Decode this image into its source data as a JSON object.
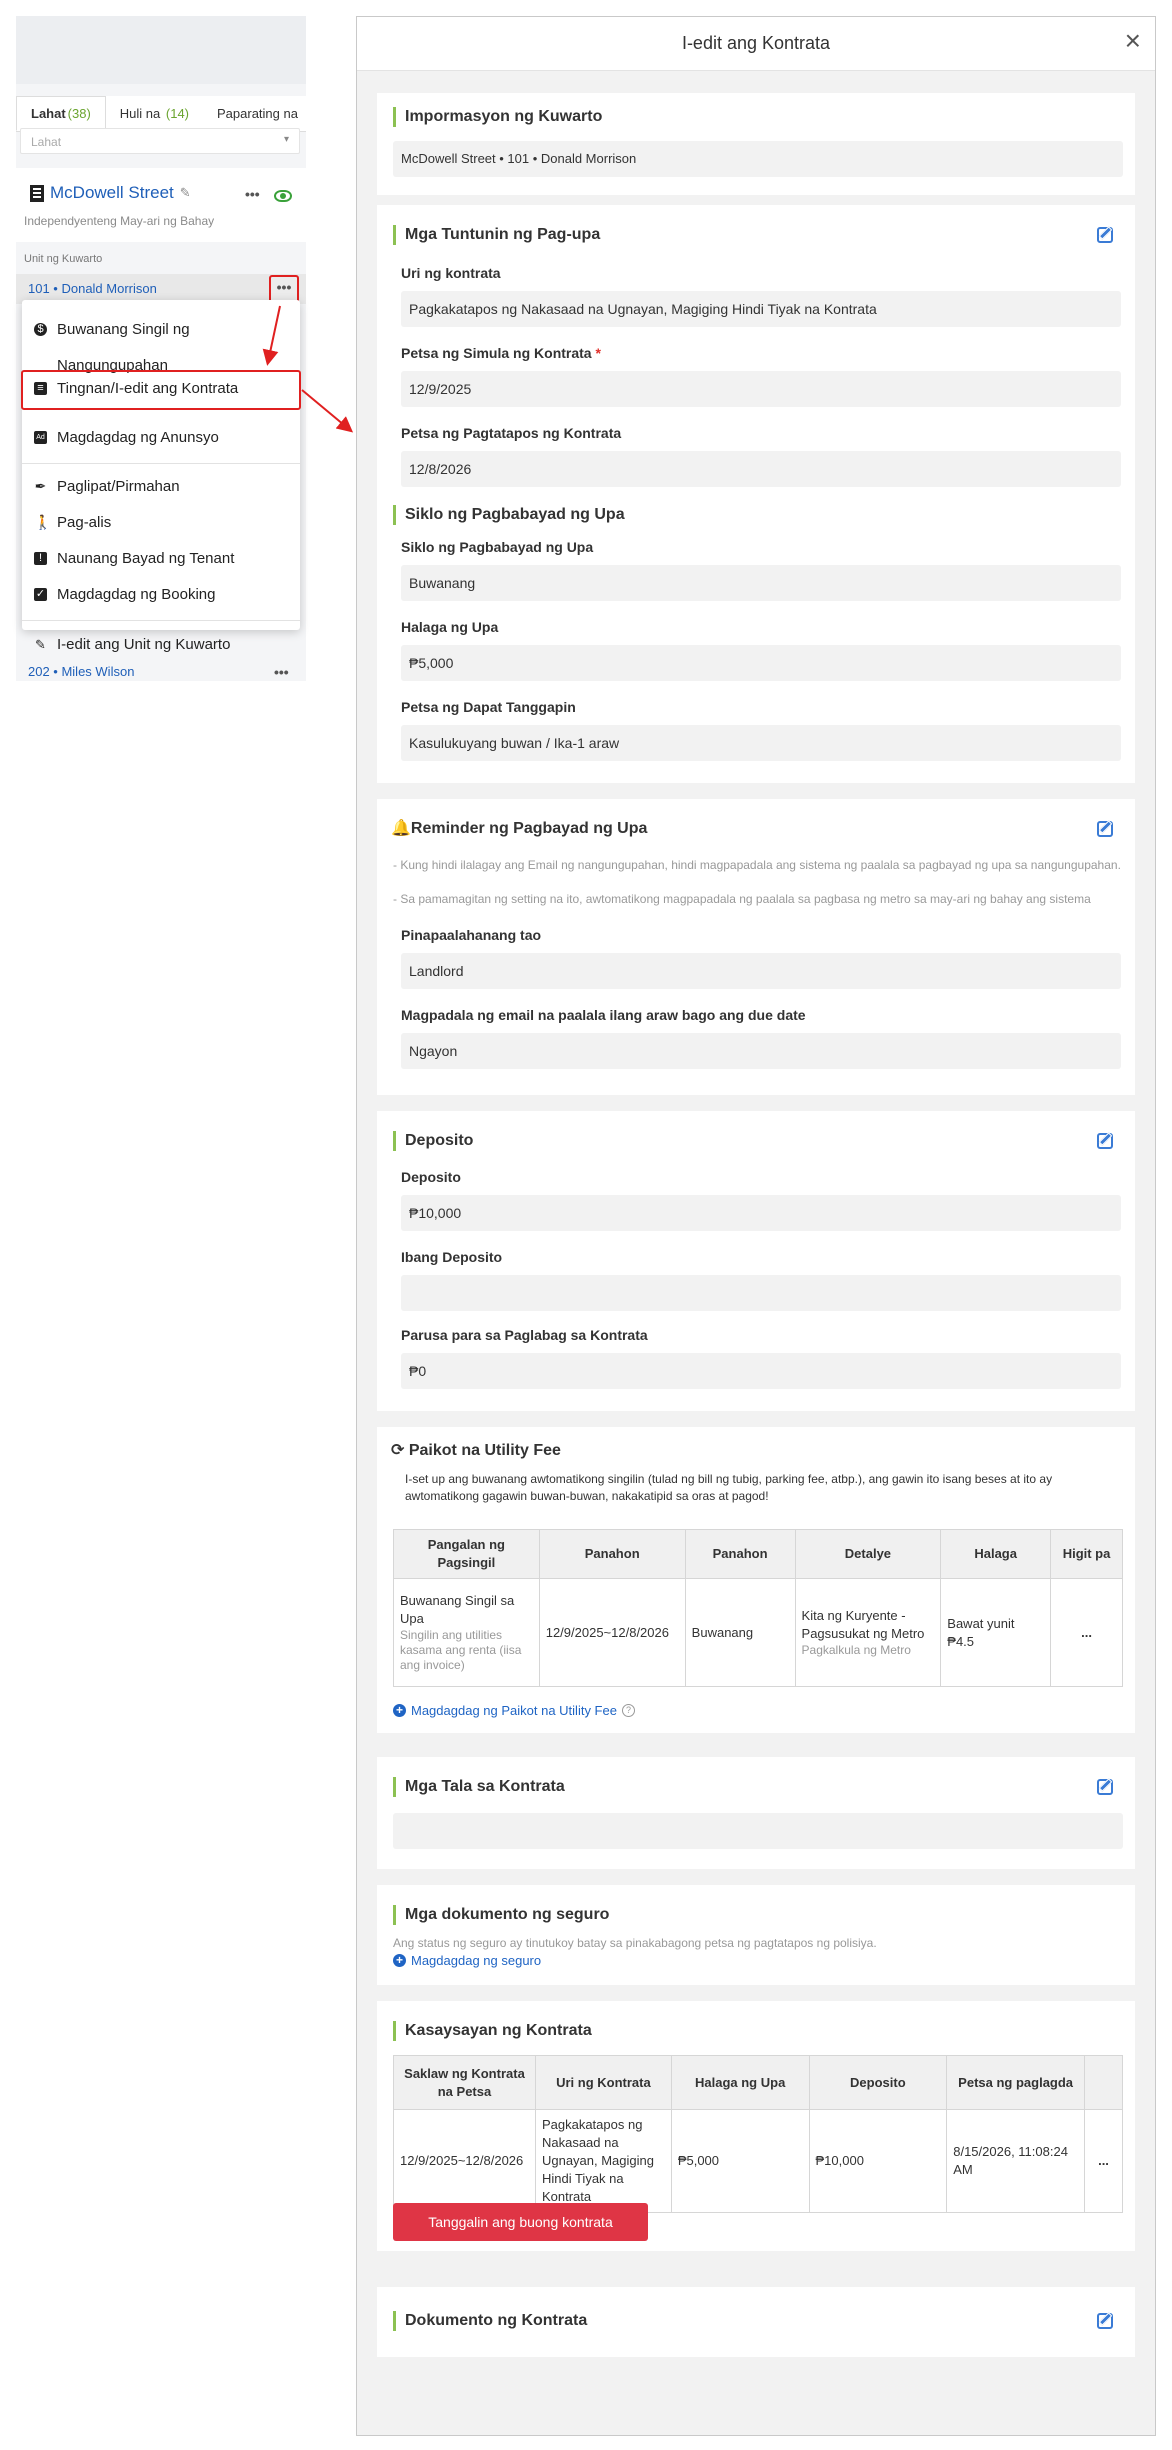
{
  "left": {
    "tabs": [
      {
        "label": "Lahat",
        "count": "(38)"
      },
      {
        "label": "Huli na",
        "count": "(14)"
      },
      {
        "label": "Paparating na",
        "count": ""
      }
    ],
    "filter_value": "Lahat",
    "property_name": "McDowell Street",
    "property_subtitle": "Independyenteng May-ari ng Bahay",
    "unit_header": "Unit ng Kuwarto",
    "unit_row": "101 • Donald Morrison",
    "unit_row2": "202 • Miles Wilson",
    "menu": {
      "items": [
        "Buwanang Singil ng Nangungupahan",
        "Tingnan/I-edit ang Kontrata",
        "Magdagdag ng Anunsyo",
        "Paglipat/Pirmahan",
        "Pag-alis",
        "Naunang Bayad ng Tenant",
        "Magdagdag ng Booking",
        "I-edit ang Unit ng Kuwarto"
      ]
    }
  },
  "modal": {
    "title": "I-edit ang Kontrata",
    "room_info": {
      "title": "Impormasyon ng Kuwarto",
      "value": "McDowell Street • 101 • Donald Morrison"
    },
    "rental_terms": {
      "title": "Mga Tuntunin ng Pag-upa",
      "contract_type_label": "Uri ng kontrata",
      "contract_type": "Pagkakatapos ng Nakasaad na Ugnayan, Magiging Hindi Tiyak na Kontrata",
      "start_label": "Petsa ng Simula ng Kontrata",
      "start": "12/9/2025",
      "end_label": "Petsa ng Pagtatapos ng Kontrata",
      "end": "12/8/2026"
    },
    "payment_cycle": {
      "title": "Siklo ng Pagbabayad ng Upa",
      "cycle_label": "Siklo ng Pagbabayad ng Upa",
      "cycle": "Buwanang",
      "rent_label": "Halaga ng Upa",
      "rent": "₱5,000",
      "due_label": "Petsa ng Dapat Tanggapin",
      "due": "Kasulukuyang buwan / Ika-1 araw"
    },
    "reminder": {
      "title": "Reminder ng Pagbayad ng Upa",
      "note1": "- Kung hindi ilalagay ang Email ng nangungupahan, hindi magpapadala ang sistema ng paalala sa pagbayad ng upa sa nangungupahan.",
      "note2": "- Sa pamamagitan ng setting na ito, awtomatikong magpapadala ng paalala sa pagbasa ng metro sa may-ari ng bahay ang sistema",
      "person_label": "Pinapaalahanang tao",
      "person": "Landlord",
      "days_label": "Magpadala ng email na paalala ilang araw bago ang due date",
      "days": "Ngayon"
    },
    "deposit": {
      "title": "Deposito",
      "deposit_label": "Deposito",
      "deposit": "₱10,000",
      "other_label": "Ibang Deposito",
      "other": "",
      "penalty_label": "Parusa para sa Paglabag sa Kontrata",
      "penalty": "₱0"
    },
    "utility": {
      "title": "Paikot na Utility Fee",
      "note": "I-set up ang buwanang awtomatikong singilin (tulad ng bill ng tubig, parking fee, atbp.), ang gawin ito isang beses at ito ay awtomatikong gagawin buwan-buwan, nakakatipid sa oras at pagod!",
      "headers": [
        "Pangalan ng Pagsingil",
        "Panahon",
        "Panahon",
        "Detalye",
        "Halaga",
        "Higit pa"
      ],
      "row": {
        "name": "Buwanang Singil sa Upa",
        "name_sub": "Singilin ang utilities kasama ang renta (iisa ang invoice)",
        "period": "12/9/2025~12/8/2026",
        "cycle": "Buwanang",
        "detail": "Kita ng Kuryente - Pagsusukat ng Metro",
        "detail_sub": "Pagkalkula ng Metro",
        "amount": "Bawat yunit ₱4.5",
        "more": "..."
      },
      "add_link": "Magdagdag ng Paikot na Utility Fee"
    },
    "notes": {
      "title": "Mga Tala sa Kontrata",
      "value": ""
    },
    "insurance": {
      "title": "Mga dokumento ng seguro",
      "note": "Ang status ng seguro ay tinutukoy batay sa pinakabagong petsa ng pagtatapos ng polisiya.",
      "add_link": "Magdagdag ng seguro"
    },
    "history": {
      "title": "Kasaysayan ng Kontrata",
      "headers": [
        "Saklaw ng Kontrata na Petsa",
        "Uri ng Kontrata",
        "Halaga ng Upa",
        "Deposito",
        "Petsa ng paglagda",
        ""
      ],
      "row": {
        "range": "12/9/2025~12/8/2026",
        "type": "Pagkakatapos ng Nakasaad na Ugnayan, Magiging Hindi Tiyak na Kontrata",
        "rent": "₱5,000",
        "deposit": "₱10,000",
        "signed": "8/15/2026, 11:08:24 AM",
        "more": "..."
      },
      "delete_button": "Tanggalin ang buong kontrata"
    },
    "documents": {
      "title": "Dokumento ng Kontrata"
    }
  },
  "colors": {
    "accent_green": "#8cc152",
    "link_blue": "#1f64c4",
    "danger_red": "#df3545",
    "highlight_red": "#e02020"
  }
}
